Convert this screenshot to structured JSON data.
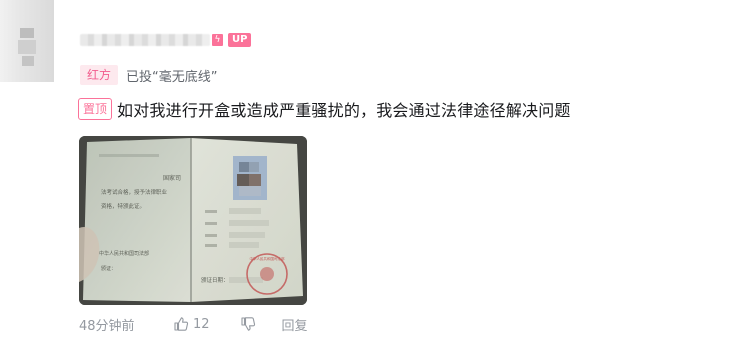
{
  "user": {
    "up_badge": "UP",
    "level_glyph": "ϟ"
  },
  "vote": {
    "side_label": "红方",
    "text": "已投“毫无底线”"
  },
  "comment": {
    "pinned_label": "置顶",
    "text": "如对我进行开盒或造成严重骚扰的，我会通过法律途径解决问题"
  },
  "photo": {
    "right_page_header": "国家司",
    "left_lines": [
      "法考试合格，授予法律职业",
      "资格，特颁此证。"
    ],
    "issuer": "中华人民共和国司法部",
    "issue_prefix": "颁证：",
    "issue_date_label": "颁证日期：",
    "seal_text": "中华人民共和国司法部"
  },
  "actions": {
    "time": "48分钟前",
    "like_count": "12",
    "reply_label": "回复"
  },
  "colors": {
    "accent_pink": "#fb7299",
    "vote_tag_bg": "#fde9ee",
    "muted_text": "#9499a0"
  },
  "icons": [
    "lightning-icon",
    "thumbs-up-icon",
    "thumbs-down-icon"
  ]
}
